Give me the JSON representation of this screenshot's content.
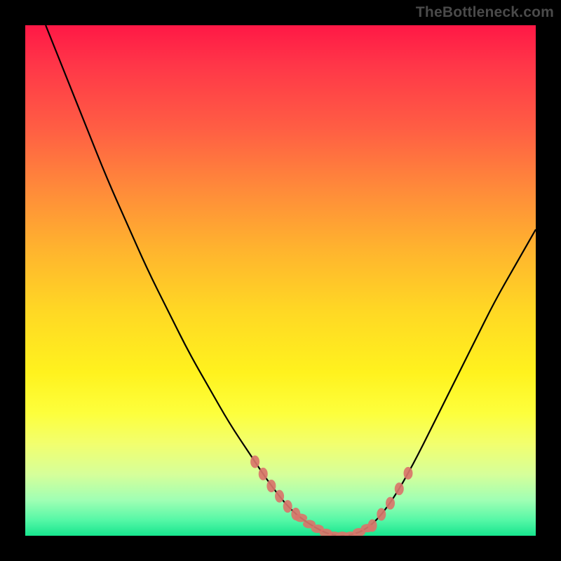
{
  "watermark": {
    "text": "TheBottleneck.com"
  },
  "chart_data": {
    "type": "line",
    "title": "",
    "xlabel": "",
    "ylabel": "",
    "xlim": [
      0,
      100
    ],
    "ylim": [
      0,
      100
    ],
    "grid": false,
    "series": [
      {
        "name": "bottleneck-curve",
        "color": "#000000",
        "x": [
          4,
          8,
          12,
          16,
          20,
          24,
          28,
          32,
          36,
          40,
          44,
          48,
          52,
          56,
          60,
          64,
          68,
          72,
          76,
          80,
          84,
          88,
          92,
          96,
          100
        ],
        "y": [
          100,
          90,
          80,
          70,
          61,
          52,
          44,
          36,
          29,
          22,
          16,
          10,
          5,
          2,
          0,
          0,
          2,
          7,
          14,
          22,
          30,
          38,
          46,
          53,
          60
        ]
      }
    ],
    "markers": [
      {
        "name": "marker-cluster-left",
        "x_range": [
          45,
          53
        ],
        "y_range": [
          3,
          24
        ],
        "color": "#d9756a"
      },
      {
        "name": "marker-cluster-right",
        "x_range": [
          68,
          75
        ],
        "y_range": [
          3,
          22
        ],
        "color": "#d9756a"
      },
      {
        "name": "marker-cluster-bottom",
        "x_range": [
          54,
          67
        ],
        "y_range": [
          0,
          3
        ],
        "color": "#d9756a"
      }
    ],
    "background_gradient": {
      "top": "#ff1846",
      "mid": "#ffd824",
      "bottom": "#17e58e"
    }
  }
}
